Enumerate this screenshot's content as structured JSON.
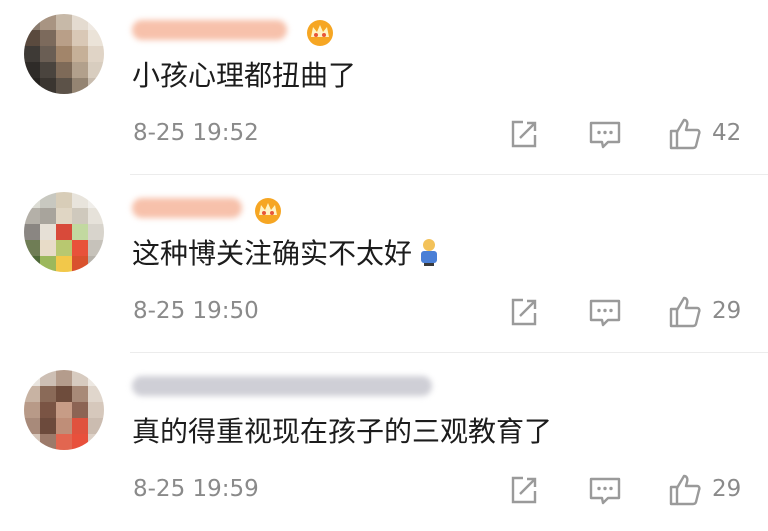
{
  "comments": [
    {
      "text": "小孩心理都扭曲了",
      "time": "8-25 19:52",
      "likes": "42"
    },
    {
      "text": "这种博关注确实不太好",
      "time": "8-25 19:50",
      "likes": "29"
    },
    {
      "text": "真的得重视现在孩子的三观教育了",
      "time": "8-25 19:59",
      "likes": "29"
    }
  ],
  "icons": {
    "share": "share-icon",
    "reply": "comment-icon",
    "like": "thumbs-up-icon",
    "badge": "crown-badge-icon"
  },
  "colors": {
    "name_blur": "#f6b8a0",
    "name_blur_gray": "#c8c8d0",
    "badge": "#f6a623",
    "meta_text": "#8a8a8a"
  }
}
